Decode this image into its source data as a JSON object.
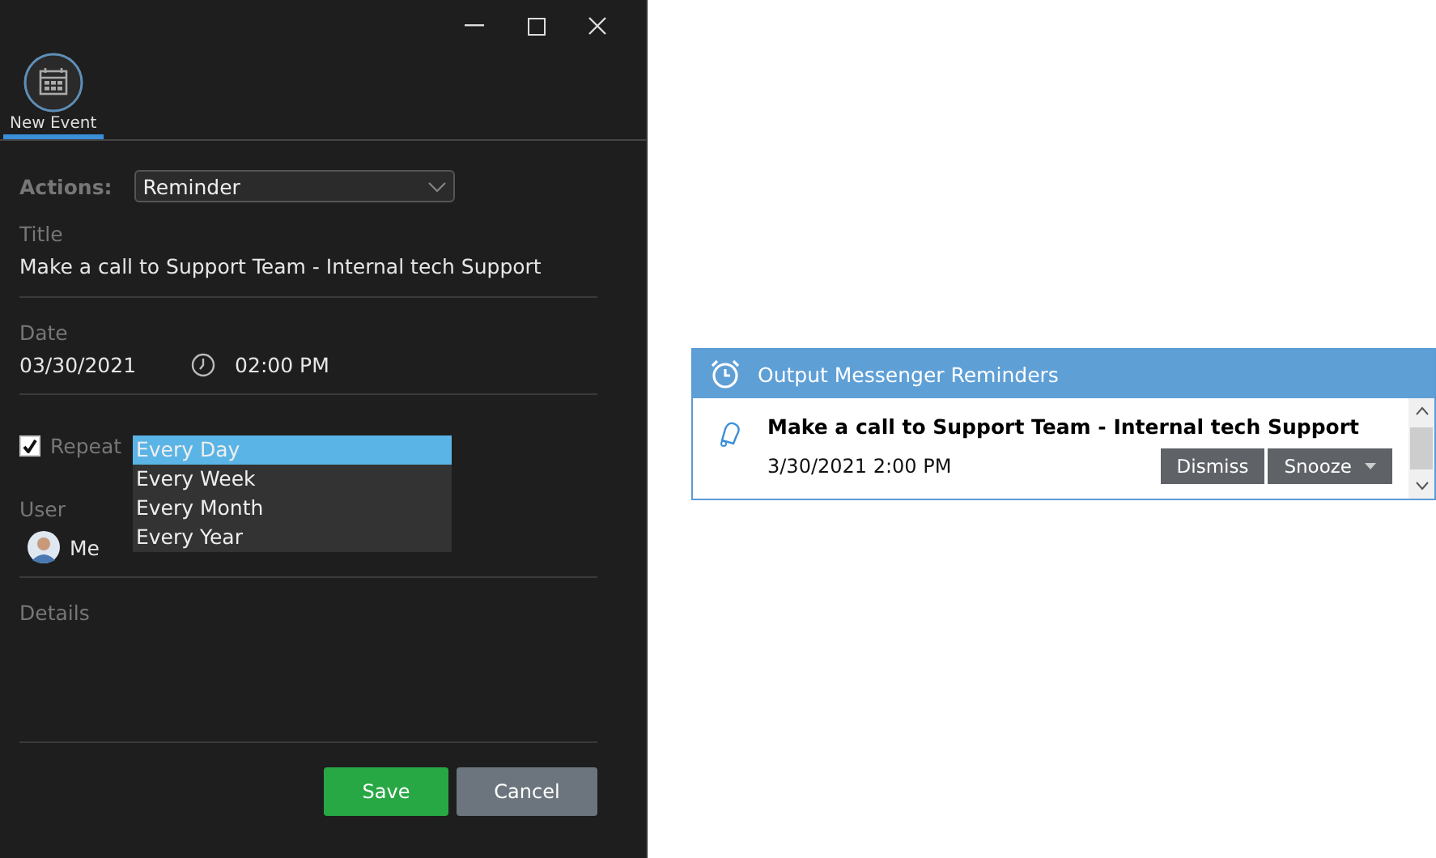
{
  "toolbar": {
    "tab": {
      "label": "New Event",
      "selected": true
    }
  },
  "form": {
    "actions_label": "Actions:",
    "action_value": "Reminder",
    "title_label": "Title",
    "title_value": "Make a call to Support Team - Internal tech Support",
    "date_label": "Date",
    "date_value": "03/30/2021",
    "time_value": "02:00 PM",
    "repeat": {
      "label": "Repeat",
      "checked": true,
      "options": [
        {
          "label": "Every Day",
          "selected": true
        },
        {
          "label": "Every Week",
          "selected": false
        },
        {
          "label": "Every Month",
          "selected": false
        },
        {
          "label": "Every Year",
          "selected": false
        }
      ]
    },
    "user_label": "User",
    "user_value": "Me",
    "details_label": "Details"
  },
  "buttons": [
    {
      "label": "Save",
      "kind": "primary"
    },
    {
      "label": "Cancel",
      "kind": "secondary"
    }
  ],
  "reminder": {
    "title": "Output Messenger Reminders",
    "item_title": "Make a call to Support Team - Internal tech Support",
    "item_time": "3/30/2021 2:00 PM",
    "dismiss": "Dismiss",
    "snooze": "Snooze"
  }
}
